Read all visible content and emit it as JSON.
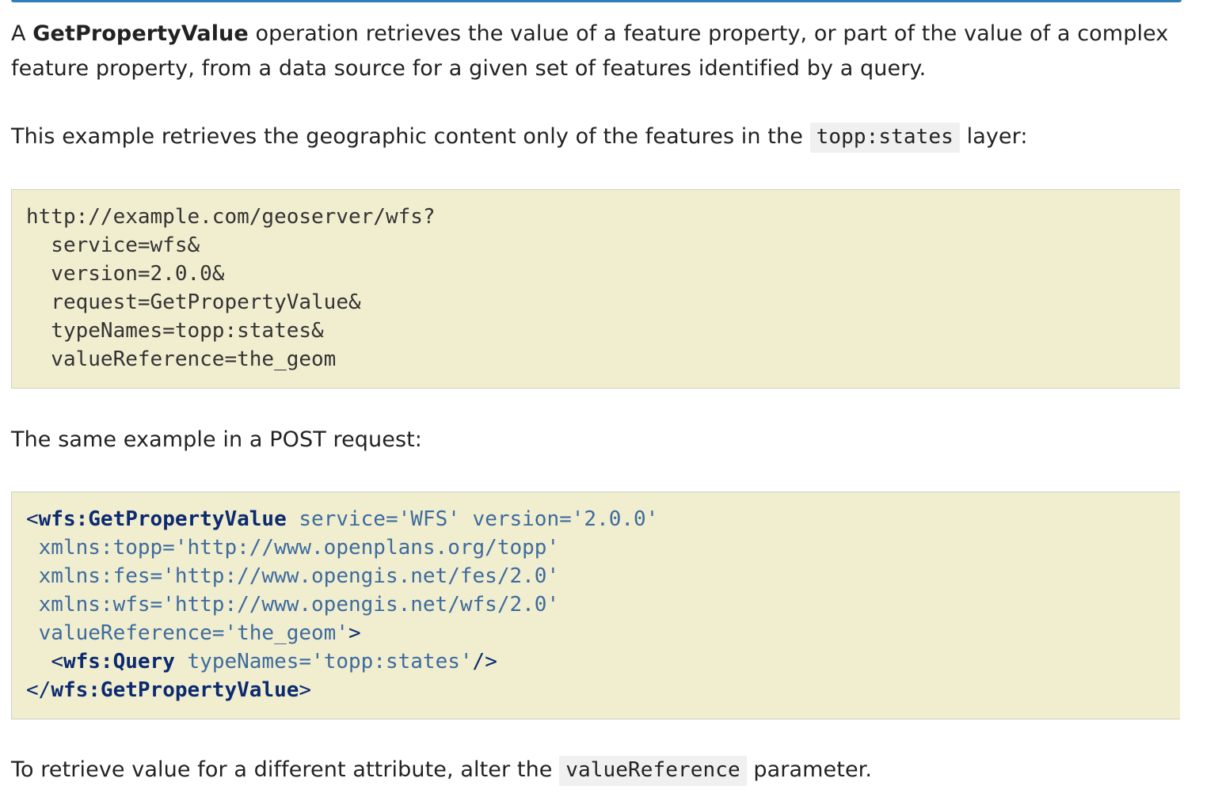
{
  "intro": {
    "lead": "A ",
    "term": "GetPropertyValue",
    "line1_rest": " operation retrieves the value of a feature property, or part of the value of a complex",
    "line2": "feature property, from a data source for a given set of features identified by a query."
  },
  "example_intro": {
    "before": "This example retrieves the geographic content only of the features in the ",
    "code": "topp:states",
    "after": " layer:"
  },
  "get_request": {
    "lines": [
      "http://example.com/geoserver/wfs?",
      "  service=wfs&",
      "  version=2.0.0&",
      "  request=GetPropertyValue&",
      "  typeNames=topp:states&",
      "  valueReference=the_geom"
    ]
  },
  "post_intro": "The same example in a POST request:",
  "post_request": {
    "l1_open": "<",
    "l1_tag": "wfs:GetPropertyValue",
    "l1_attrs": " service='WFS' version='2.0.0'",
    "l2": " xmlns:topp='http://www.openplans.org/topp'",
    "l3": " xmlns:fes='http://www.opengis.net/fes/2.0'",
    "l4": " xmlns:wfs='http://www.opengis.net/wfs/2.0'",
    "l5_attrs": " valueReference='the_geom'",
    "l5_close": ">",
    "l6_indent": "  ",
    "l6_open": "<",
    "l6_tag": "wfs:Query",
    "l6_attrs": " typeNames='topp:states'",
    "l6_close": "/>",
    "l7_open": "</",
    "l7_tag": "wfs:GetPropertyValue",
    "l7_close": ">"
  },
  "outro": {
    "before": "To retrieve value for a different attribute, alter the ",
    "code": "valueReference",
    "after": " parameter."
  }
}
